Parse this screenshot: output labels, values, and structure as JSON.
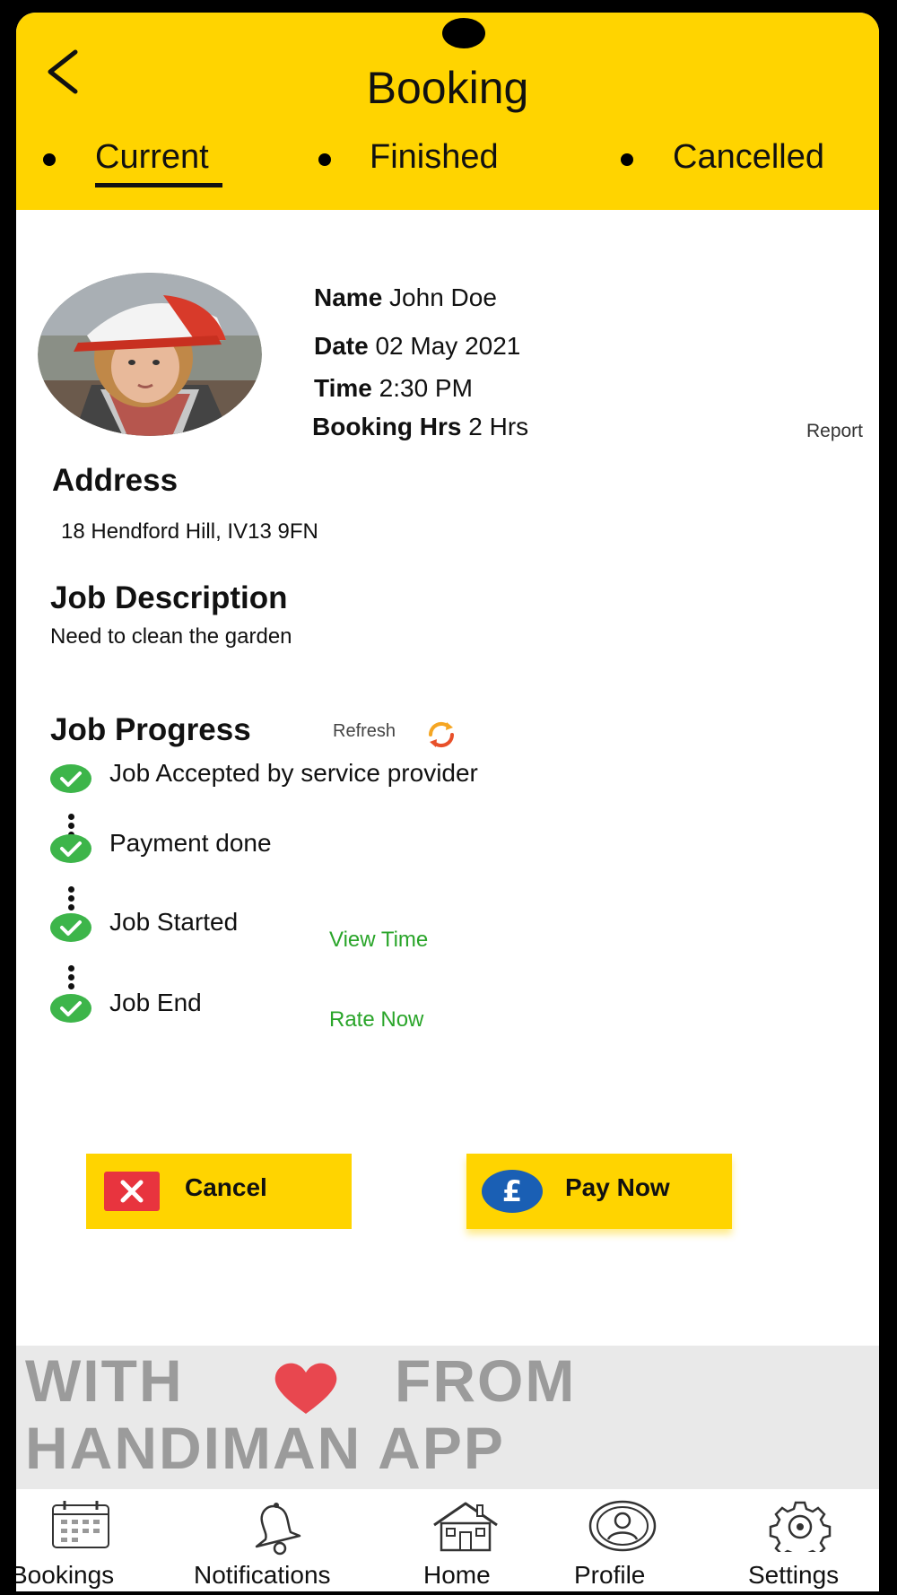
{
  "header": {
    "title": "Booking",
    "tabs": [
      {
        "label": "Current",
        "active": true
      },
      {
        "label": "Finished",
        "active": false
      },
      {
        "label": "Cancelled",
        "active": false
      }
    ]
  },
  "booking": {
    "name_label": "Name",
    "name_value": "John Doe",
    "date_label": "Date",
    "date_value": "02 May 2021",
    "time_label": "Time",
    "time_value": "2:30 PM",
    "hours_label": "Booking Hrs",
    "hours_value": "2 Hrs",
    "report": "Report"
  },
  "address": {
    "heading": "Address",
    "value": "18 Hendford Hill, IV13 9FN"
  },
  "description": {
    "heading": "Job Description",
    "value": "Need to clean the garden"
  },
  "progress": {
    "heading": "Job Progress",
    "refresh": "Refresh",
    "steps": [
      {
        "label": "Job Accepted by service provider",
        "done": true
      },
      {
        "label": "Payment done",
        "done": true
      },
      {
        "label": "Job Started",
        "done": true,
        "action": "View Time"
      },
      {
        "label": "Job End",
        "done": true,
        "action": "Rate Now"
      }
    ]
  },
  "actions": {
    "cancel": "Cancel",
    "pay": "Pay Now"
  },
  "banner": {
    "line1a": "WITH",
    "line1b": "FROM",
    "line2": "HANDIMAN APP"
  },
  "nav": {
    "bookings": "Bookings",
    "notifications": "Notifications",
    "home": "Home",
    "profile": "Profile",
    "settings": "Settings"
  },
  "colors": {
    "accent": "#FFD400",
    "success": "#3DB54A",
    "link": "#2AA52A",
    "danger": "#E8343E",
    "pay_icon": "#1A5FB4"
  }
}
